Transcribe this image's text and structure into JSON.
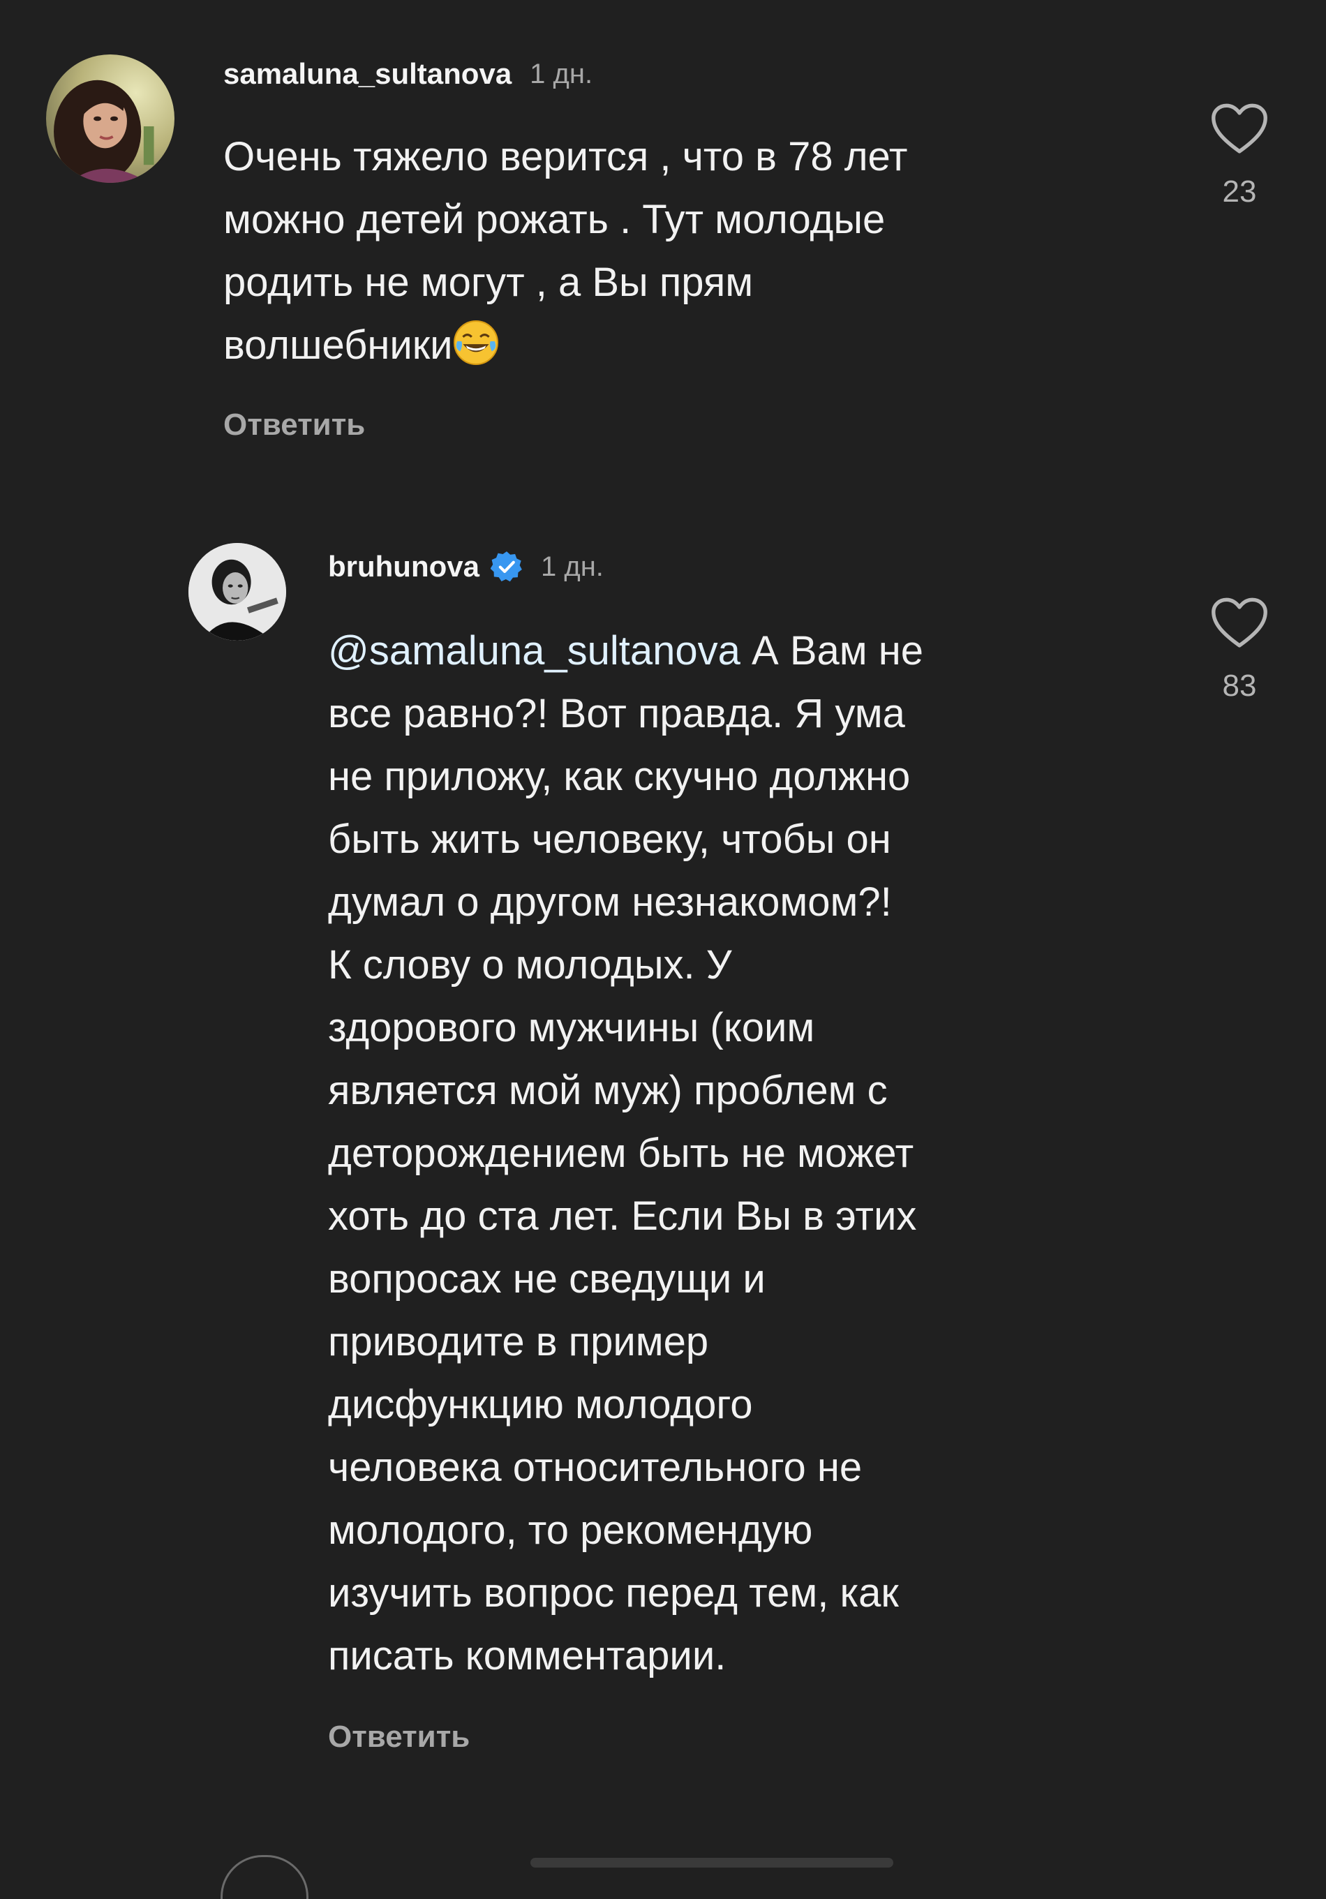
{
  "comments": [
    {
      "username": "samaluna_sultanova",
      "time": "1 дн.",
      "text": "Очень тяжело верится , что в 78 лет\nможно детей рожать . Тут молодые\nродить не могут , а Вы прям\nволшебники",
      "emoji": "face-with-tears-of-joy",
      "reply_label": "Ответить",
      "likes": "23"
    }
  ],
  "replies": [
    {
      "username": "bruhunova",
      "verified": true,
      "time": "1 дн.",
      "mention": "@samaluna_sultanova",
      "text_first_line_rest": " А Вам не",
      "text": "все равно?! Вот правда. Я ума\nне приложу, как скучно должно\nбыть жить человеку, чтобы он\nдумал о другом незнакомом?!\nК слову о молодых. У\nздорового мужчины (коим\nявляется мой муж) проблем с\nдеторождением быть не может\nхоть до ста лет. Если Вы в этих\nвопросах не сведущи и\nприводите в пример\nдисфункцию молодого\nчеловека относительного не\nмолодого, то рекомендую\nизучить вопрос перед тем, как\nписать комментарии.",
      "reply_label": "Ответить",
      "likes": "83"
    }
  ],
  "icons": {
    "like": "heart-outline-icon",
    "verified": "verified-badge-icon"
  },
  "colors": {
    "background": "#202020",
    "text": "#f2f2f2",
    "secondary": "#a8a8a8",
    "verified": "#3897f0"
  }
}
